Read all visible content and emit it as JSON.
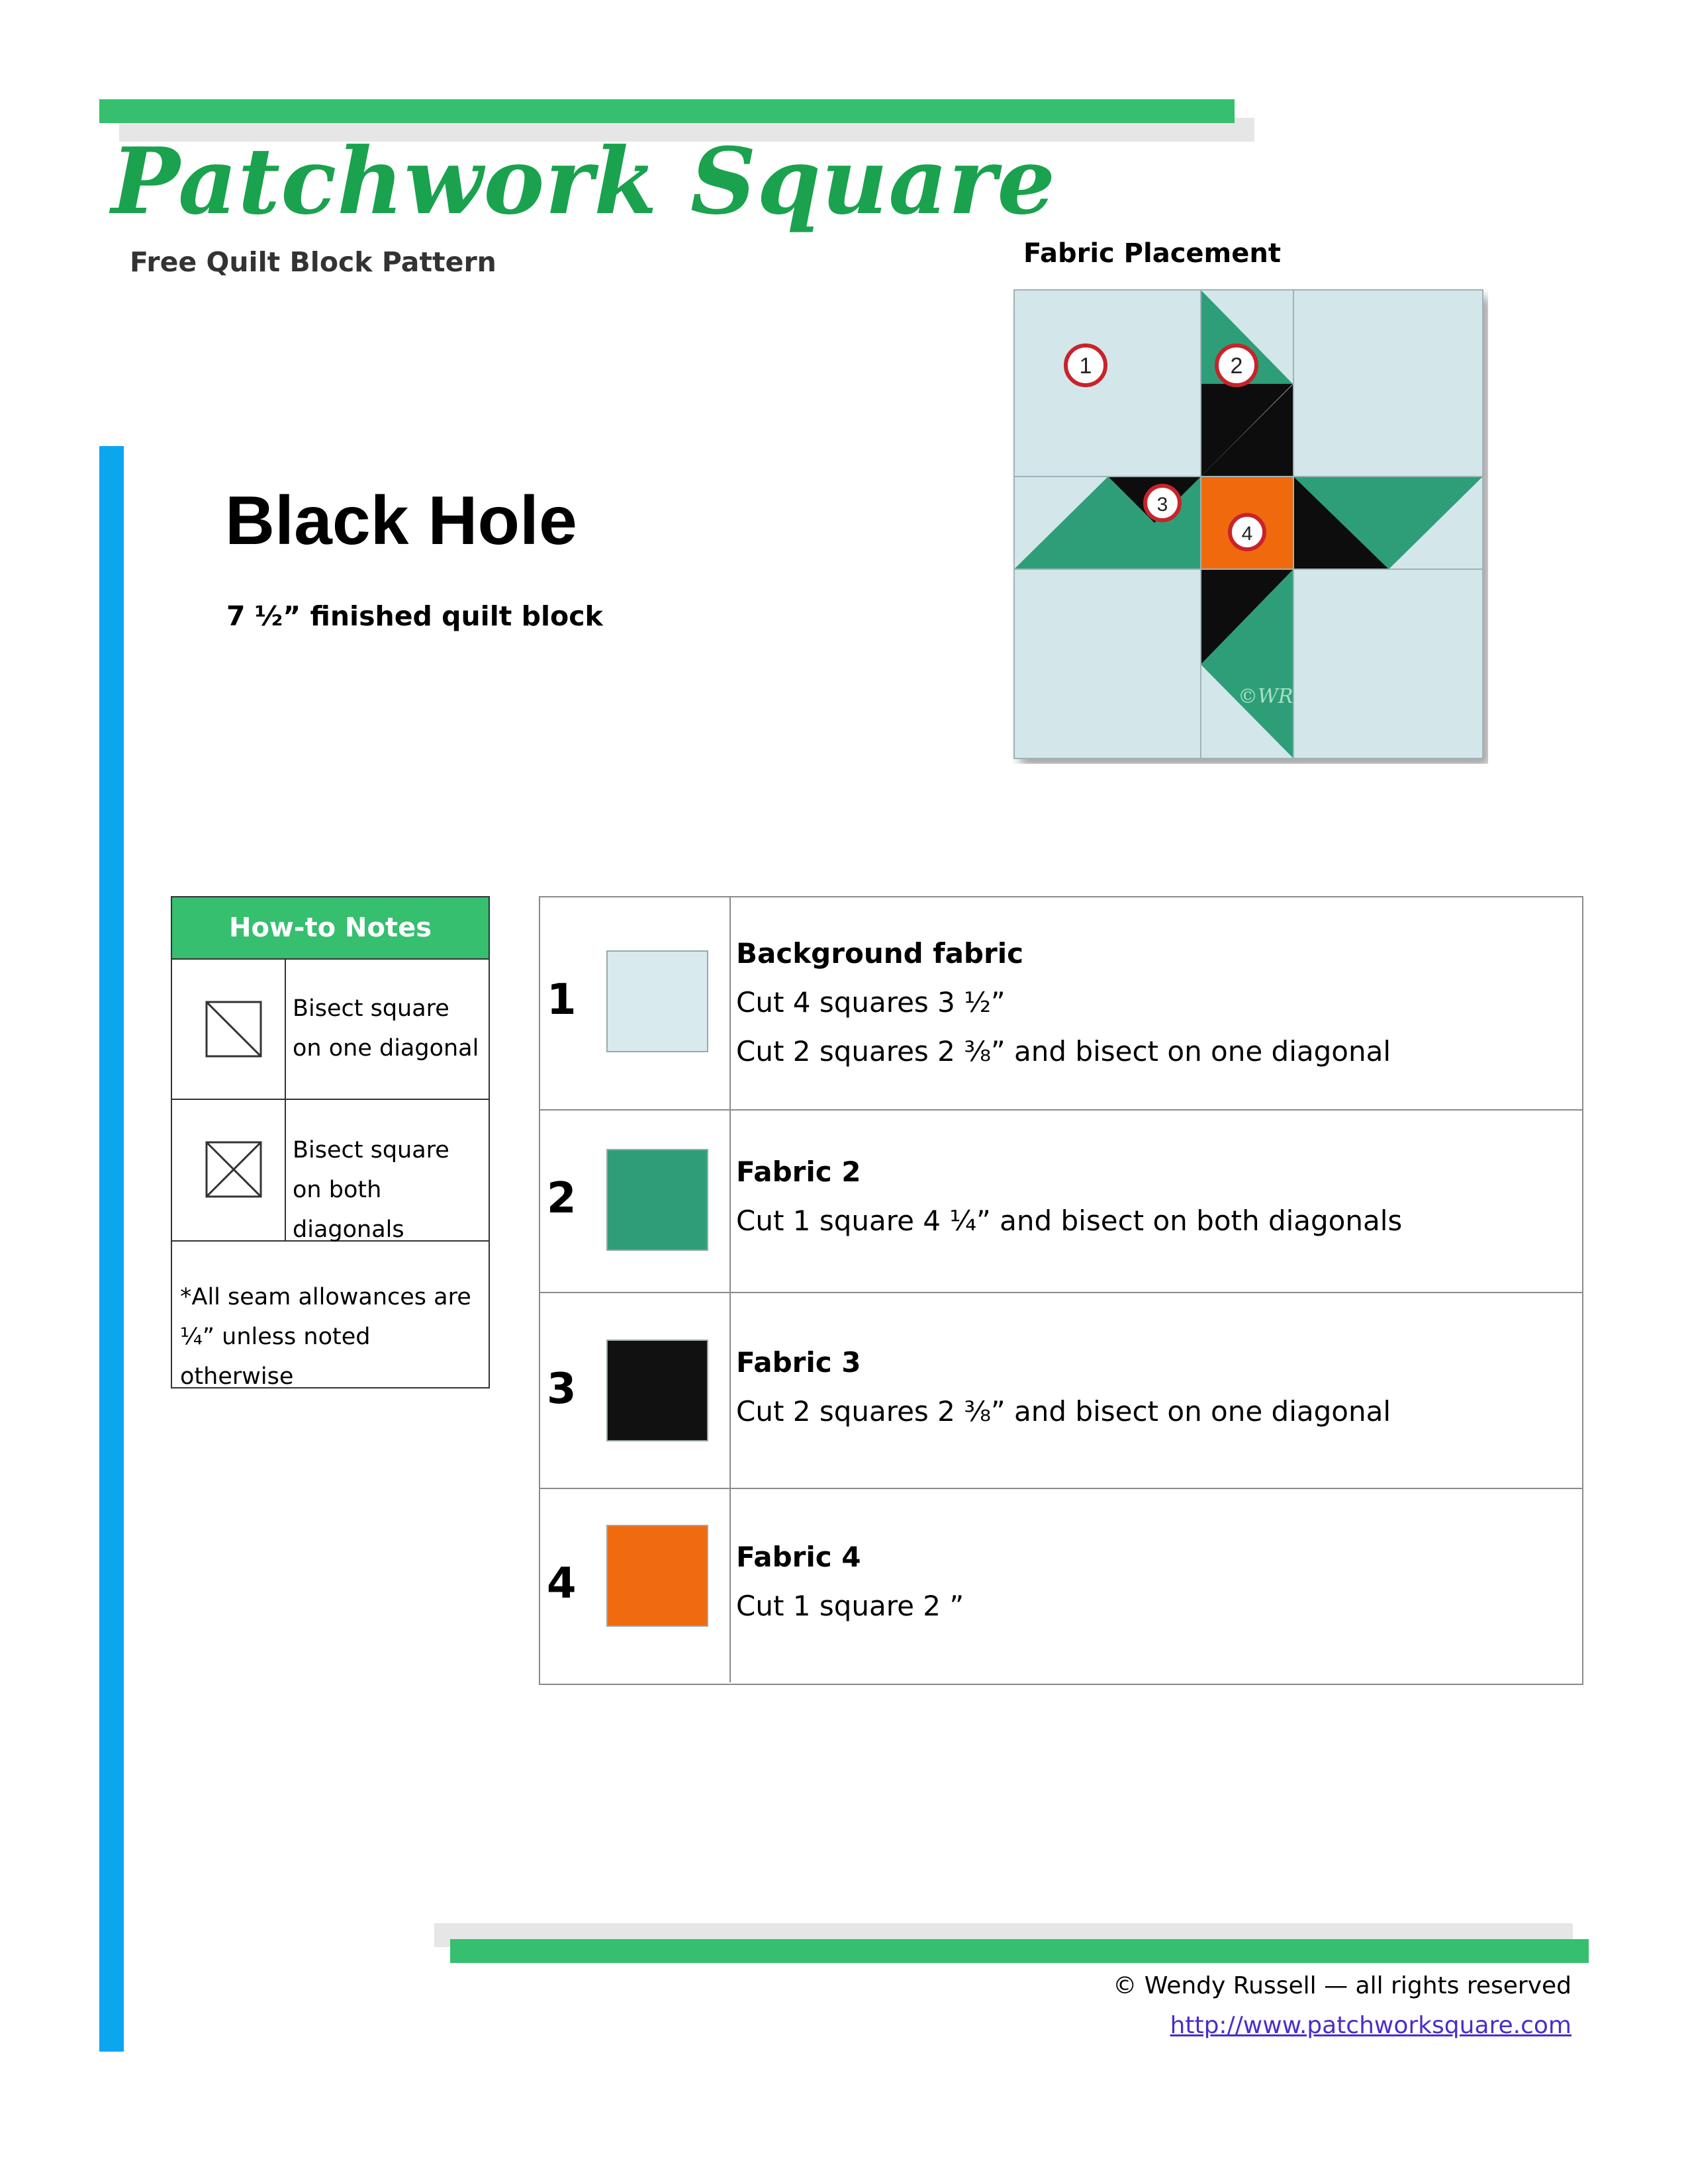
{
  "brand": {
    "title": "Patchwork Square",
    "subtitle": "Free Quilt Block Pattern"
  },
  "block": {
    "name": "Black Hole",
    "size": "7 ½” finished quilt block"
  },
  "placement": {
    "label": "Fabric Placement",
    "markers": [
      "1",
      "2",
      "3",
      "4"
    ],
    "copyright_mark": "©WR",
    "colors": {
      "background": "#d3e7ea",
      "fabric2": "#2f9e78",
      "fabric3": "#111111",
      "fabric4": "#f06b10"
    }
  },
  "howto": {
    "header": "How-to Notes",
    "rows": [
      {
        "icon": "one-diagonal-icon",
        "text": "Bisect square on one diagonal"
      },
      {
        "icon": "both-diagonals-icon",
        "text": "Bisect square on both diagonals"
      }
    ],
    "note": "*All seam allowances are ¼” unless noted otherwise"
  },
  "fabrics": [
    {
      "number": "1",
      "name": "Background fabric",
      "color": "#d8eaee",
      "lines": [
        "Cut 4 squares 3 ½”",
        "Cut 2 squares 2 ⅜” and bisect on one diagonal"
      ]
    },
    {
      "number": "2",
      "name": "Fabric 2",
      "color": "#2f9e78",
      "lines": [
        "Cut 1 square 4 ¼” and bisect on both diagonals"
      ]
    },
    {
      "number": "3",
      "name": "Fabric 3",
      "color": "#111111",
      "lines": [
        "Cut 2 squares 2 ⅜” and bisect on one diagonal"
      ]
    },
    {
      "number": "4",
      "name": "Fabric 4",
      "color": "#f06b10",
      "lines": [
        "Cut 1 square 2 ”"
      ]
    }
  ],
  "footer": {
    "copyright": "© Wendy Russell — all rights reserved",
    "link": "http://www.patchworksquare.com"
  }
}
